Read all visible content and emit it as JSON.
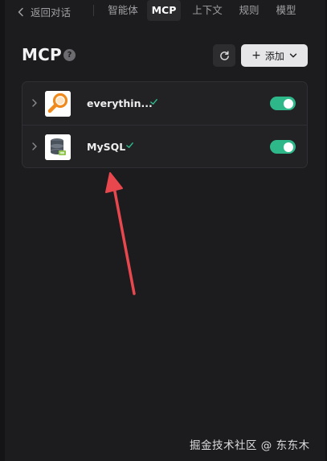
{
  "nav": {
    "back_label": "返回对话",
    "tabs": [
      {
        "label": "智能体",
        "active": false
      },
      {
        "label": "MCP",
        "active": true
      },
      {
        "label": "上下文",
        "active": false
      },
      {
        "label": "规则",
        "active": false
      },
      {
        "label": "模型",
        "active": false
      }
    ]
  },
  "header": {
    "title": "MCP",
    "help_glyph": "?",
    "add_label": "添加",
    "refresh_icon": "refresh-icon",
    "add_icon": "plus-icon"
  },
  "servers": [
    {
      "name": "everythin...",
      "verified": true,
      "enabled": true,
      "logo": "search-magnifier-logo"
    },
    {
      "name": "MySQL",
      "verified": true,
      "enabled": true,
      "logo": "database-logo"
    }
  ],
  "watermark": "掘金技术社区 @ 东东木",
  "colors": {
    "background": "#1c1c1e",
    "toggle_on": "#2eb88a",
    "check": "#2eb88a",
    "annotation_arrow": "#e8474e",
    "logo_orange": "#f08a1c"
  }
}
